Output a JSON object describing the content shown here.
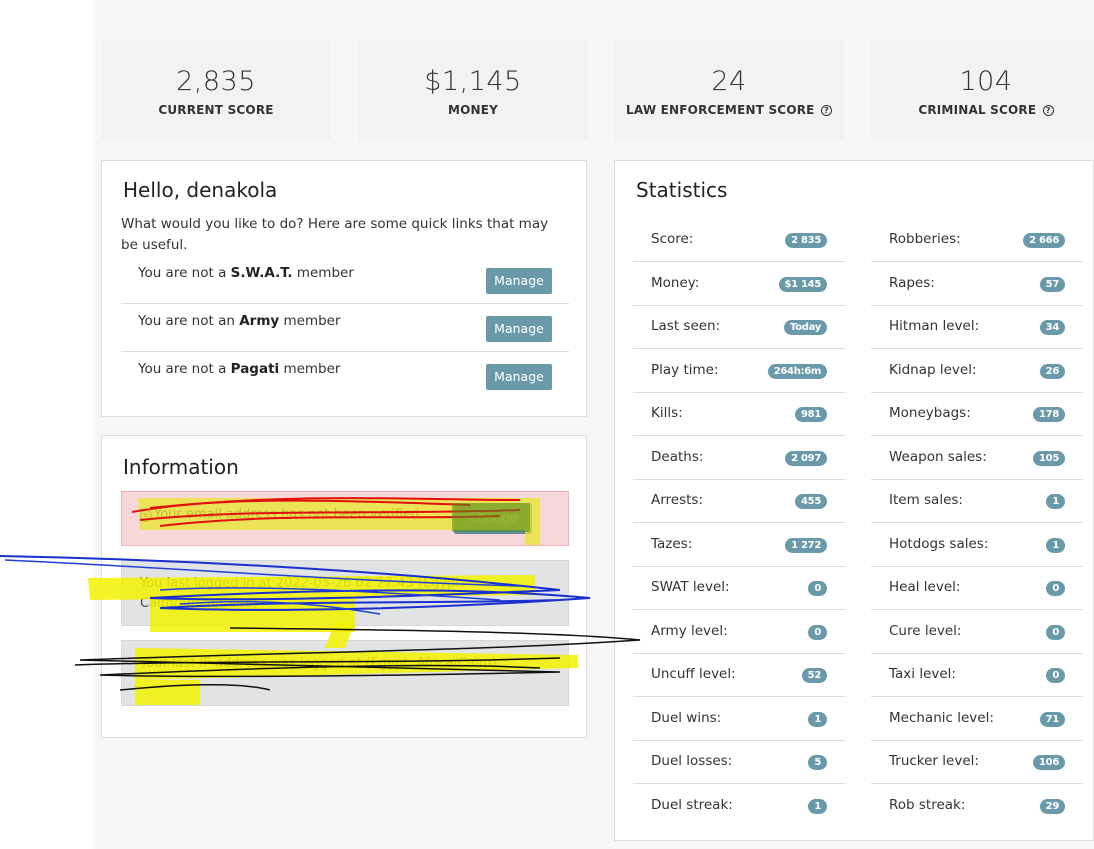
{
  "summary": [
    {
      "value": "2,835",
      "label": "CURRENT SCORE",
      "help": false
    },
    {
      "value": "$1,145",
      "label": "MONEY",
      "help": false
    },
    {
      "value": "24",
      "label": "LAW ENFORCEMENT SCORE",
      "help": true
    },
    {
      "value": "104",
      "label": "CRIMINAL SCORE",
      "help": true
    }
  ],
  "hello": {
    "title": "Hello, denakola",
    "intro": "What would you like to do? Here are some quick links that may be useful.",
    "memberships": [
      {
        "prefix": "You are not a ",
        "group": "S.W.A.T.",
        "suffix": " member",
        "button": "Manage"
      },
      {
        "prefix": "You are not an ",
        "group": "Army",
        "suffix": " member",
        "button": "Manage"
      },
      {
        "prefix": "You are not a ",
        "group": "Pagati",
        "suffix": " member",
        "button": "Manage"
      }
    ]
  },
  "information": {
    "title": "Information",
    "alert_email": {
      "text": "Your email address has not been verified.",
      "button": "Change"
    },
    "alert_last_login": {
      "text": "You last logged in at 2022-05-26 02:27:43 (Egypt, Cairo/Africa/Cairo)"
    },
    "alert_last_ip": {
      "text": "Your last IP address was logged at (Egypt, Africa/Cairo)"
    }
  },
  "statistics": {
    "title": "Statistics",
    "left": [
      {
        "label": "Score:",
        "value": "2 835"
      },
      {
        "label": "Money:",
        "value": "$1 145"
      },
      {
        "label": "Last seen:",
        "value": "Today"
      },
      {
        "label": "Play time:",
        "value": "264h:6m"
      },
      {
        "label": "Kills:",
        "value": "981"
      },
      {
        "label": "Deaths:",
        "value": "2 097"
      },
      {
        "label": "Arrests:",
        "value": "455"
      },
      {
        "label": "Tazes:",
        "value": "1 272"
      },
      {
        "label": "SWAT level:",
        "value": "0"
      },
      {
        "label": "Army level:",
        "value": "0"
      },
      {
        "label": "Uncuff level:",
        "value": "52"
      },
      {
        "label": "Duel wins:",
        "value": "1"
      },
      {
        "label": "Duel losses:",
        "value": "5"
      },
      {
        "label": "Duel streak:",
        "value": "1"
      }
    ],
    "right": [
      {
        "label": "Robberies:",
        "value": "2 666"
      },
      {
        "label": "Rapes:",
        "value": "57"
      },
      {
        "label": "Hitman level:",
        "value": "34"
      },
      {
        "label": "Kidnap level:",
        "value": "26"
      },
      {
        "label": "Moneybags:",
        "value": "178"
      },
      {
        "label": "Weapon sales:",
        "value": "105"
      },
      {
        "label": "Item sales:",
        "value": "1"
      },
      {
        "label": "Hotdogs sales:",
        "value": "1"
      },
      {
        "label": "Heal level:",
        "value": "0"
      },
      {
        "label": "Cure level:",
        "value": "0"
      },
      {
        "label": "Taxi level:",
        "value": "0"
      },
      {
        "label": "Mechanic level:",
        "value": "71"
      },
      {
        "label": "Trucker level:",
        "value": "106"
      },
      {
        "label": "Rob streak:",
        "value": "29"
      }
    ]
  },
  "colors": {
    "accent": "#6a9aaa",
    "alert_red": "#f8d7da",
    "alert_grey": "#e2e3e5"
  }
}
